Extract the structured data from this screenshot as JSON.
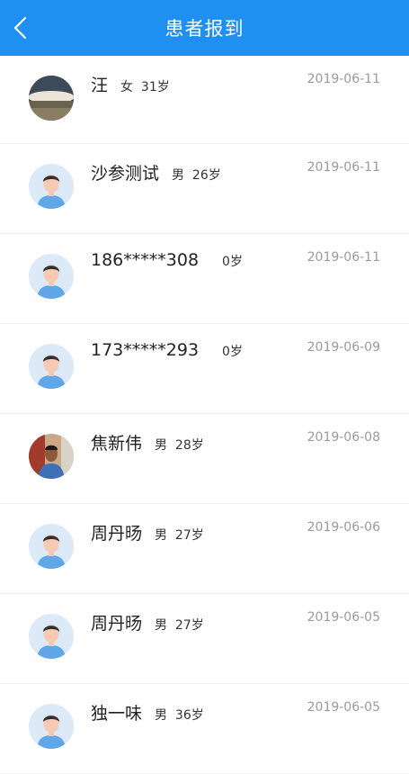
{
  "header": {
    "title": "患者报到",
    "back_icon": "chevron-left-icon",
    "bg_color": "#1f8ff2"
  },
  "patients": [
    {
      "name": "汪",
      "gender": "女",
      "age": "31岁",
      "date": "2019-06-11",
      "avatar": "photo-landscape"
    },
    {
      "name": "沙参测试",
      "gender": "男",
      "age": "26岁",
      "date": "2019-06-11",
      "avatar": "default-person-icon"
    },
    {
      "name": "186*****308",
      "gender": "",
      "age": "0岁",
      "date": "2019-06-11",
      "avatar": "default-person-icon"
    },
    {
      "name": "173*****293",
      "gender": "",
      "age": "0岁",
      "date": "2019-06-09",
      "avatar": "default-person-icon"
    },
    {
      "name": "焦新伟",
      "gender": "男",
      "age": "28岁",
      "date": "2019-06-08",
      "avatar": "photo-person"
    },
    {
      "name": "周丹旸",
      "gender": "男",
      "age": "27岁",
      "date": "2019-06-06",
      "avatar": "default-person-icon"
    },
    {
      "name": "周丹旸",
      "gender": "男",
      "age": "27岁",
      "date": "2019-06-05",
      "avatar": "default-person-icon"
    },
    {
      "name": "独一味",
      "gender": "男",
      "age": "36岁",
      "date": "2019-06-05",
      "avatar": "default-person-icon"
    }
  ]
}
